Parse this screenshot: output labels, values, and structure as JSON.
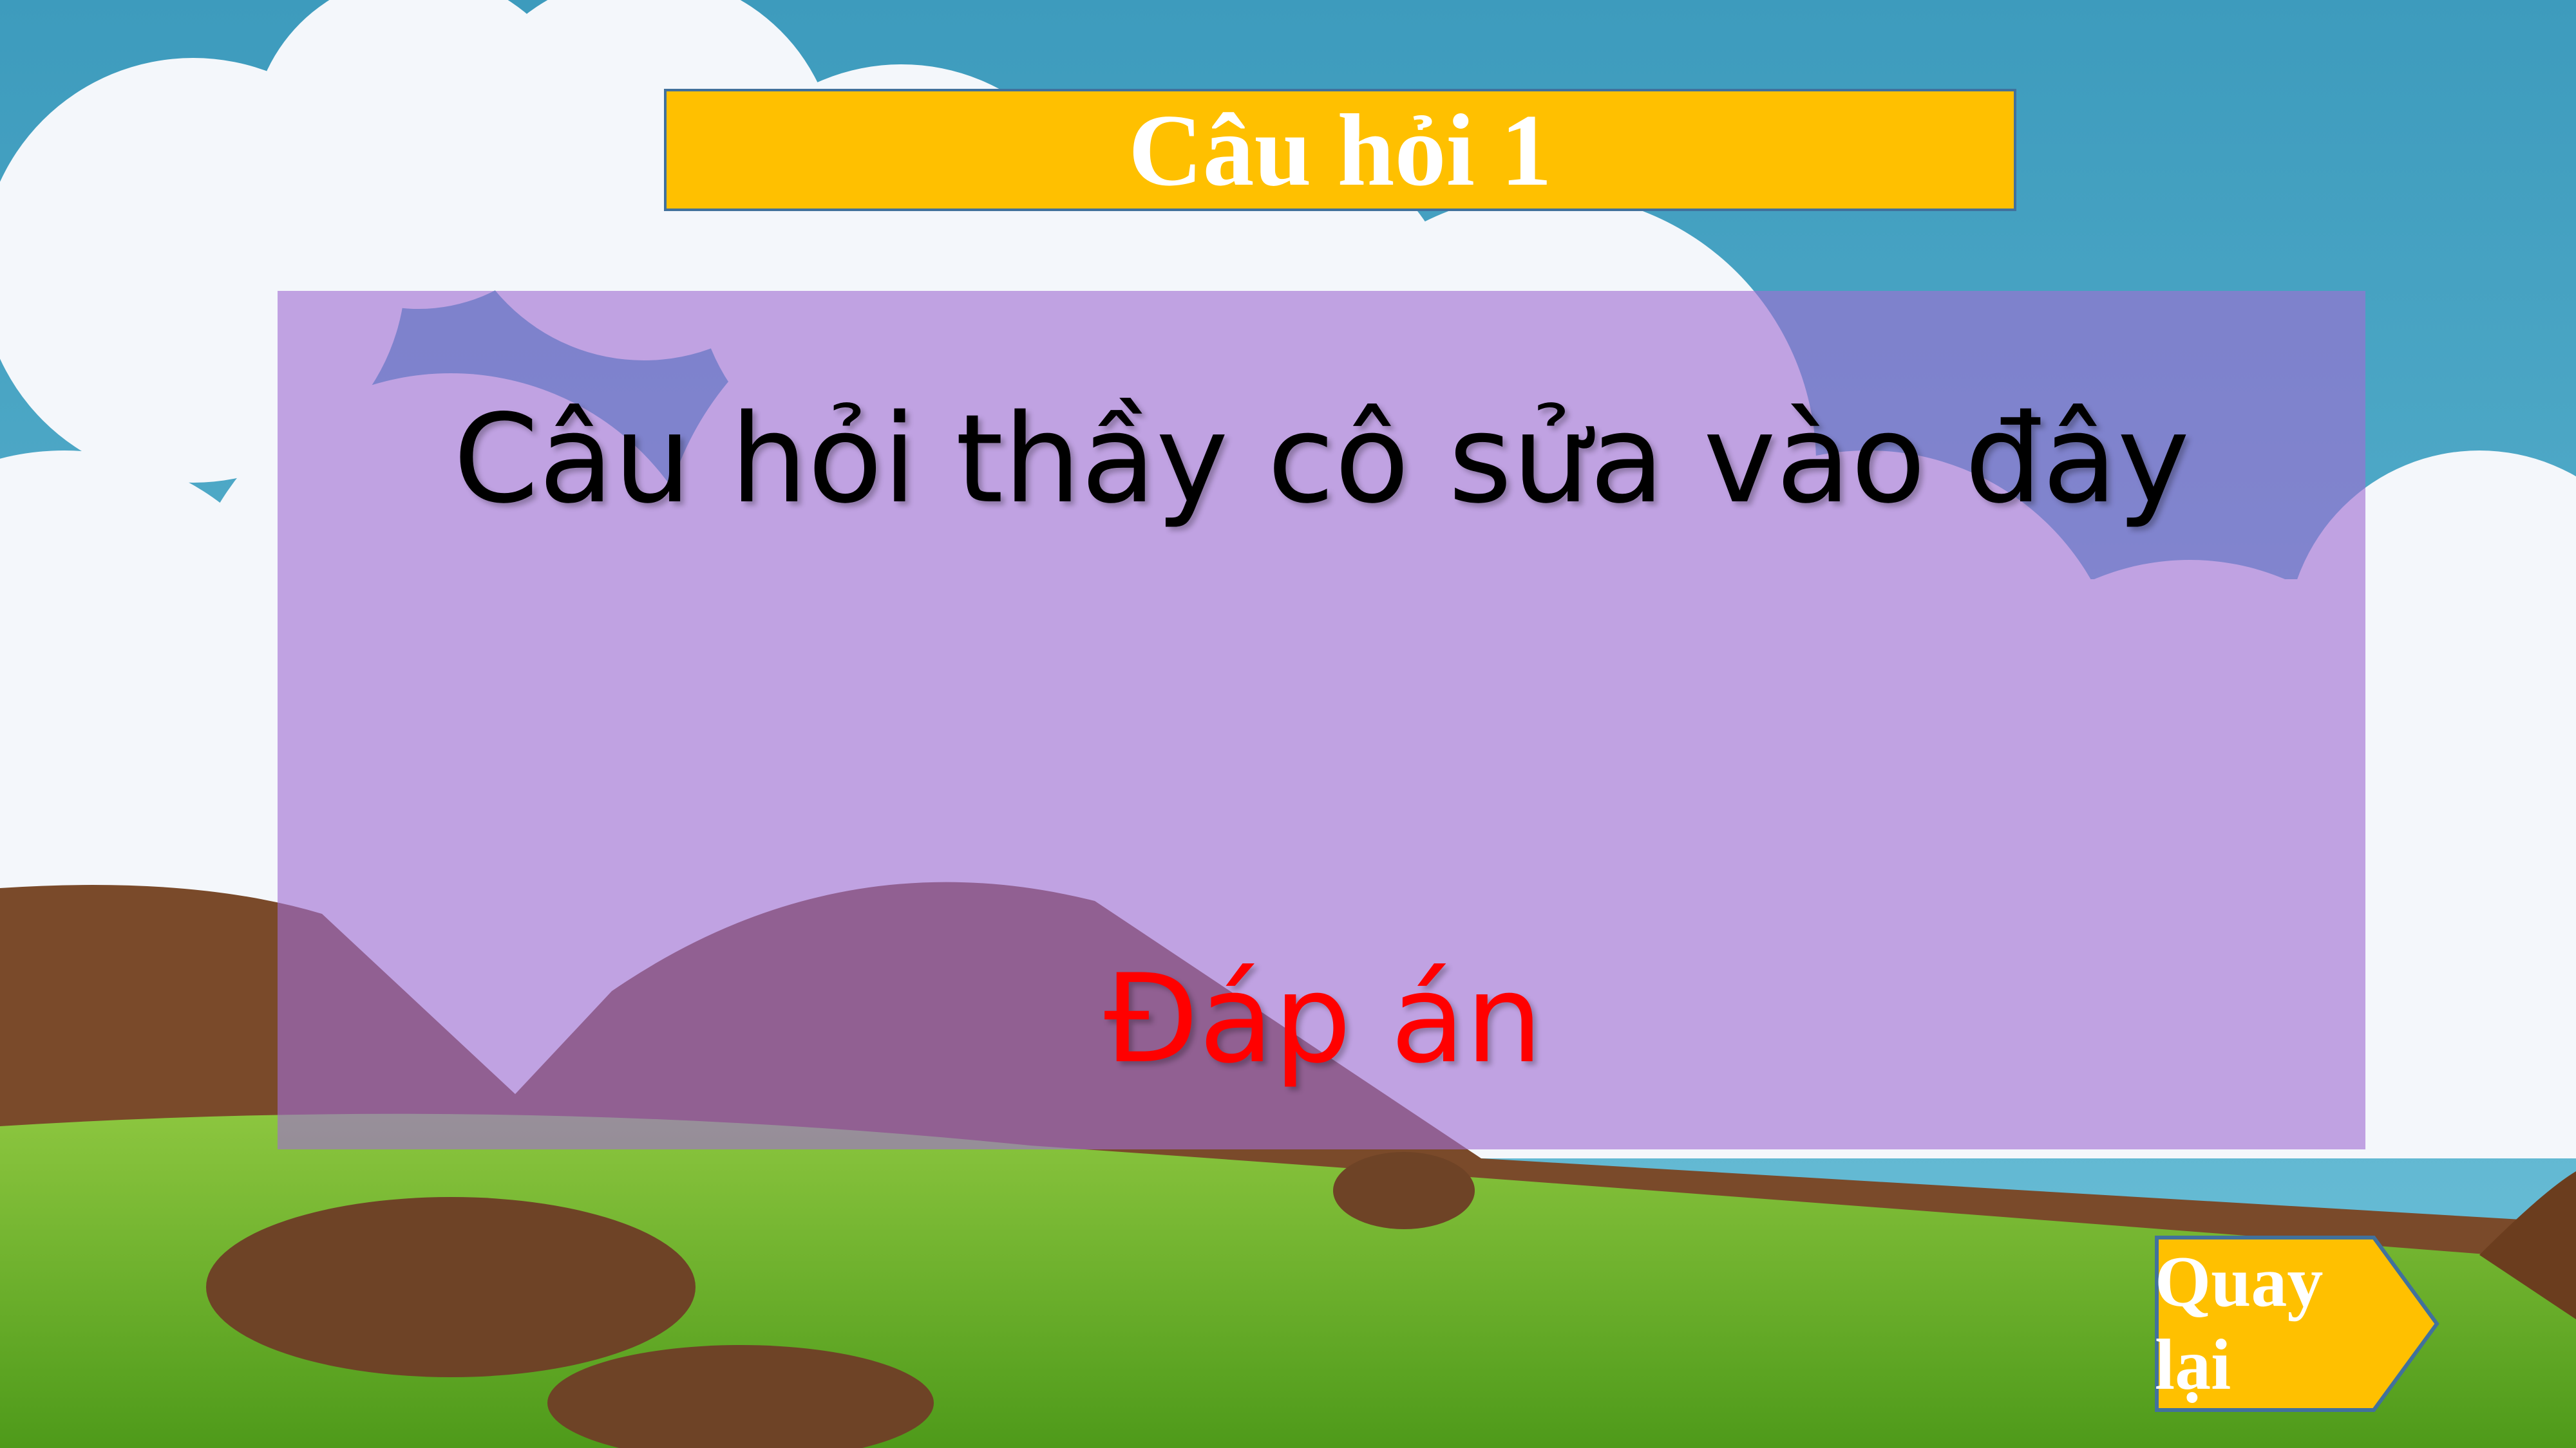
{
  "slide": {
    "title": "Câu hỏi 1",
    "question": "Câu hỏi thầy cô sửa vào đây",
    "answer": "Đáp án",
    "back_button": "Quay lại"
  },
  "colors": {
    "title_fill": "#FFC000",
    "border": "#41719C",
    "answer_text": "#FF0000",
    "panel": "#A06ED2"
  }
}
